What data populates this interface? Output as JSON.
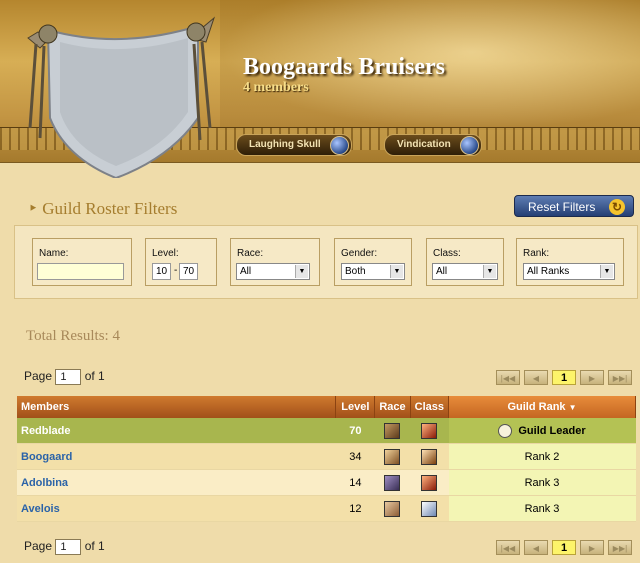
{
  "guild": {
    "name": "Boogaards Bruisers",
    "members_text": "4 members",
    "realm": "Laughing Skull",
    "battlegroup": "Vindication"
  },
  "filters": {
    "title": "Guild Roster Filters",
    "reset_label": "Reset Filters",
    "name_label": "Name:",
    "name_value": "",
    "level_label": "Level:",
    "level_min": "10",
    "level_sep": "-",
    "level_max": "70",
    "race_label": "Race:",
    "race_value": "All",
    "gender_label": "Gender:",
    "gender_value": "Both",
    "class_label": "Class:",
    "class_value": "All",
    "rank_label": "Rank:",
    "rank_value": "All Ranks"
  },
  "results": {
    "total_text": "Total Results: 4",
    "page_label": "Page",
    "page_value": "1",
    "of_text": "of 1",
    "current_page": "1"
  },
  "table": {
    "headers": {
      "members": "Members",
      "level": "Level",
      "race": "Race",
      "class": "Class",
      "rank": "Guild Rank"
    },
    "rows": [
      {
        "name": "Redblade",
        "level": "70",
        "rank": "Guild Leader"
      },
      {
        "name": "Boogaard",
        "level": "34",
        "rank": "Rank 2"
      },
      {
        "name": "Adolbina",
        "level": "14",
        "rank": "Rank 3"
      },
      {
        "name": "Avelois",
        "level": "12",
        "rank": "Rank 3"
      }
    ]
  },
  "icons": {
    "pager_first": "first-page-icon",
    "pager_prev": "previous-page-icon",
    "pager_next": "next-page-icon",
    "pager_last": "last-page-icon",
    "reset": "refresh-icon",
    "sort": "sort-down-icon",
    "guild_leader": "guild-leader-icon"
  },
  "colors": {
    "header_bar": "#b4611f",
    "leader_row": "#a8b64e",
    "member_link": "#2b63a8",
    "reset_button": "#2f4d86"
  }
}
